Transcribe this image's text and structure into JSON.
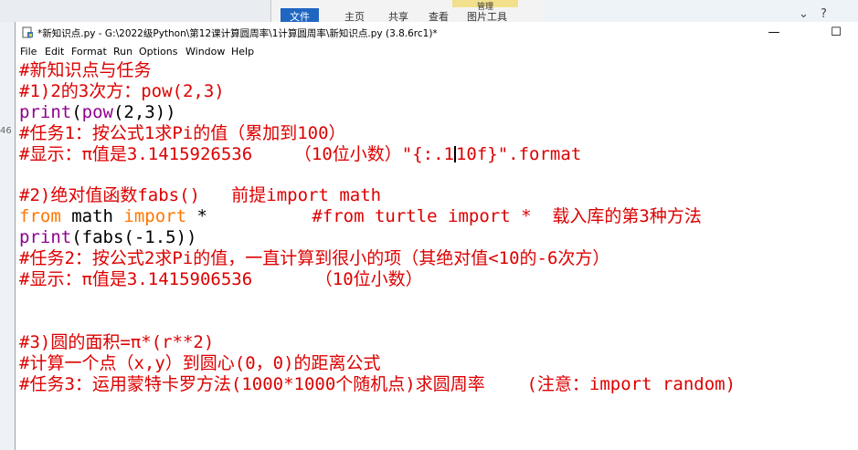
{
  "background": {
    "ribbon_tabs": [
      "文件",
      "主页",
      "共享",
      "查看"
    ],
    "ribbon_context_tab": "图片工具",
    "ribbon_manage": "管理",
    "left_edge_number": "46"
  },
  "window": {
    "title": "*新知识点.py - G:\\2022级Python\\第12课计算圆周率\\1计算圆周率\\新知识点.py (3.8.6rc1)*",
    "controls": [
      "—",
      "☐"
    ],
    "app_icon": "python-idle-icon"
  },
  "menu": [
    "File",
    "Edit",
    "Format",
    "Run",
    "Options",
    "Window",
    "Help"
  ],
  "code": {
    "l1": "#新知识点与任务",
    "l2": "#1)2的3次方：pow(2,3)",
    "l3_kw": "print",
    "l3_mid": "(",
    "l3_bi": "pow",
    "l3_rest": "(2,3))",
    "l4": "#任务1：按公式1求Pi的值（累加到100）",
    "l5_a": "#显示：π值是3.1415926536    （10位小数）\"{:.1",
    "l5_b": "10f}\".format",
    "l6": "",
    "l7": "#2)绝对值函数fabs()   前提import math",
    "l8_from": "from",
    "l8_math": " math ",
    "l8_import": "import",
    "l8_star": " *          ",
    "l8_comment": "#from turtle import *  载入库的第3种方法",
    "l9_kw": "print",
    "l9_rest": "(fabs(-1.5))",
    "l10": "#任务2：按公式2求Pi的值，一直计算到很小的项（其绝对值<10的-6次方）",
    "l11": "#显示：π值是3.1415906536      （10位小数）",
    "l12": "",
    "l13": "",
    "l14": "#3)圆的面积=π*(r**2)",
    "l15": "#计算一个点（x,y）到圆心(0，0)的距离公式",
    "l16": "#任务3：运用蒙特卡罗方法(1000*1000个随机点)求圆周率    (注意：import random)"
  },
  "colors": {
    "comment": "#dd0000",
    "keyword": "#ff7700",
    "builtin": "#900090",
    "text": "#000000"
  }
}
